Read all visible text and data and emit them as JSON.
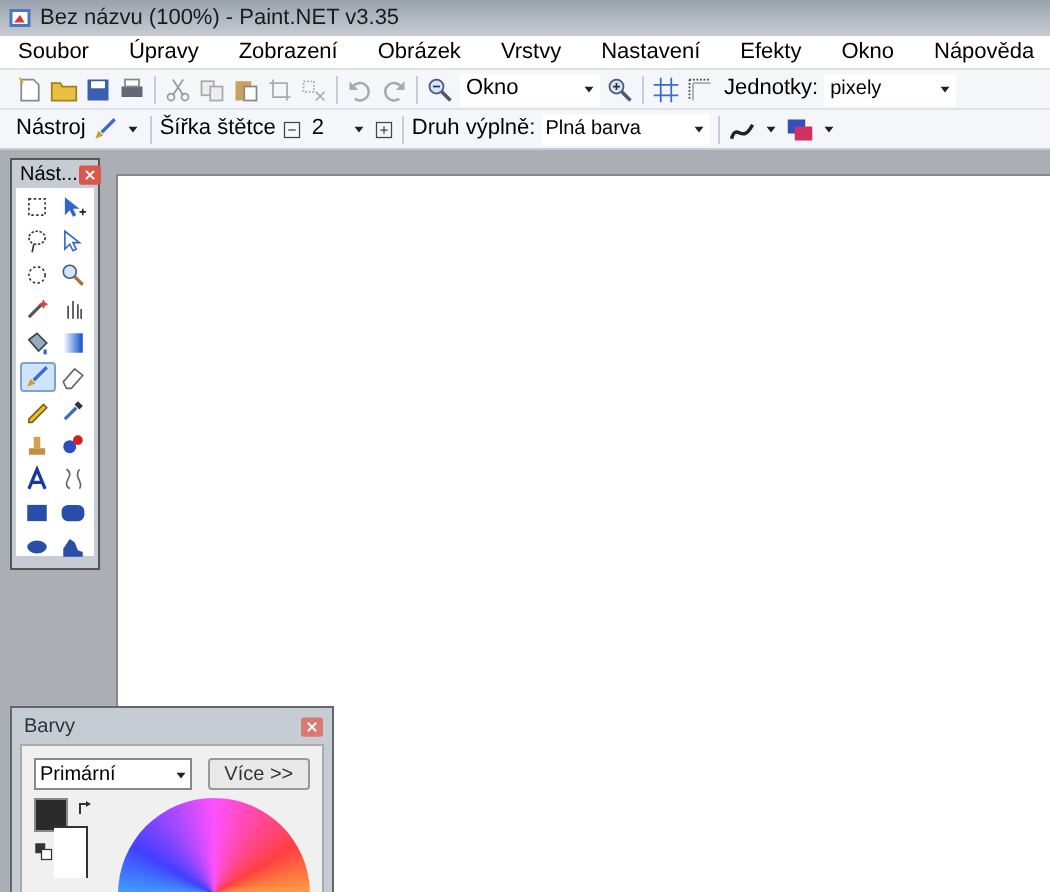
{
  "window": {
    "title": "Bez názvu (100%) - Paint.NET v3.35"
  },
  "menu": [
    {
      "label": "Soubor"
    },
    {
      "label": "Úpravy"
    },
    {
      "label": "Zobrazení"
    },
    {
      "label": "Obrázek"
    },
    {
      "label": "Vrstvy"
    },
    {
      "label": "Nastavení"
    },
    {
      "label": "Efekty"
    },
    {
      "label": "Okno"
    },
    {
      "label": "Nápověda"
    }
  ],
  "toolbar": {
    "zoom_value": "Okno",
    "units_label": "Jednotky:",
    "units_value": "pixely"
  },
  "tool_options": {
    "tool_label": "Nástroj",
    "brush_width_label": "Šířka štětce",
    "brush_width_value": "2",
    "fill_label": "Druh výplně:",
    "fill_value": "Plná barva"
  },
  "tools_window": {
    "title": "Nást...",
    "tools": [
      {
        "kind": "rectselect",
        "selected": false
      },
      {
        "kind": "move",
        "selected": false
      },
      {
        "kind": "lasso",
        "selected": false
      },
      {
        "kind": "moveoutline",
        "selected": false
      },
      {
        "kind": "ellipseselect",
        "selected": false
      },
      {
        "kind": "zoom",
        "selected": false
      },
      {
        "kind": "wand",
        "selected": false
      },
      {
        "kind": "pan",
        "selected": false
      },
      {
        "kind": "bucket",
        "selected": false
      },
      {
        "kind": "gradient",
        "selected": false
      },
      {
        "kind": "brush",
        "selected": true
      },
      {
        "kind": "eraser",
        "selected": false
      },
      {
        "kind": "pencil",
        "selected": false
      },
      {
        "kind": "picker",
        "selected": false
      },
      {
        "kind": "stamp",
        "selected": false
      },
      {
        "kind": "recolor",
        "selected": false
      },
      {
        "kind": "text",
        "selected": false
      },
      {
        "kind": "line",
        "selected": false
      },
      {
        "kind": "rect",
        "selected": false
      },
      {
        "kind": "roundrect",
        "selected": false
      },
      {
        "kind": "ellipse",
        "selected": false
      },
      {
        "kind": "freeform",
        "selected": false
      }
    ]
  },
  "colors_window": {
    "title": "Barvy",
    "mode_value": "Primární",
    "more_button": "Více >>"
  }
}
